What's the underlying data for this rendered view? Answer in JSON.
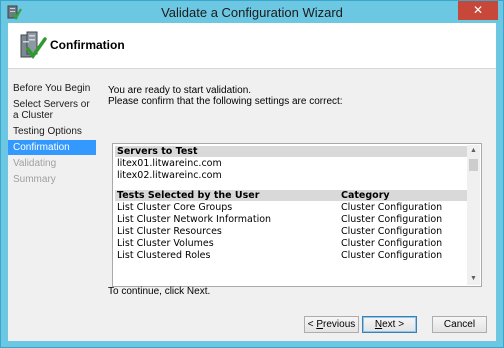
{
  "window": {
    "title": "Validate a Configuration Wizard",
    "close_glyph": "✕"
  },
  "header": {
    "title": "Confirmation"
  },
  "nav": [
    {
      "label": "Before You Begin",
      "state": "normal"
    },
    {
      "label": "Select Servers or a Cluster",
      "state": "normal"
    },
    {
      "label": "Testing Options",
      "state": "normal"
    },
    {
      "label": "Confirmation",
      "state": "active"
    },
    {
      "label": "Validating",
      "state": "disabled"
    },
    {
      "label": "Summary",
      "state": "disabled"
    }
  ],
  "intro": {
    "line1": "You are ready to start validation.",
    "line2": "Please confirm that the following settings are correct:"
  },
  "servers": {
    "header": "Servers to Test",
    "items": [
      "litex01.litwareinc.com",
      "litex02.litwareinc.com"
    ]
  },
  "tests": {
    "header_test": "Tests Selected by the User",
    "header_category": "Category",
    "rows": [
      {
        "test": "List Cluster Core Groups",
        "category": "Cluster Configuration"
      },
      {
        "test": "List Cluster Network Information",
        "category": "Cluster Configuration"
      },
      {
        "test": "List Cluster Resources",
        "category": "Cluster Configuration"
      },
      {
        "test": "List Cluster Volumes",
        "category": "Cluster Configuration"
      },
      {
        "test": "List Clustered Roles",
        "category": "Cluster Configuration"
      }
    ]
  },
  "continue_text": "To continue, click Next.",
  "buttons": {
    "previous_prefix": "< ",
    "previous_accel": "P",
    "previous_rest": "revious",
    "next_accel": "N",
    "next_rest": "ext >",
    "cancel": "Cancel"
  },
  "colors": {
    "titlebar": "#6cc7e3",
    "close": "#c7483a",
    "selected_nav": "#3399ff"
  }
}
